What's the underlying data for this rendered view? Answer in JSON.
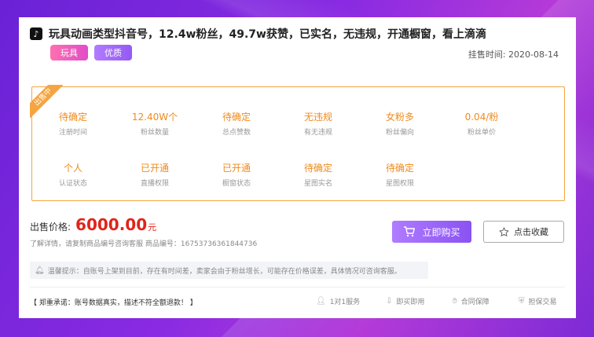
{
  "listing": {
    "title": "玩具动画类型抖音号，12.4w粉丝，49.7w获赞，已实名，无违规，开通橱窗，看上滴滴",
    "tags": [
      "玩具",
      "优质"
    ],
    "listed_date": "挂售时间: 2020-08-14",
    "status_ribbon": "出售中"
  },
  "stats": [
    {
      "value": "待确定",
      "label": "注册时间"
    },
    {
      "value": "12.40W个",
      "label": "粉丝数量"
    },
    {
      "value": "待确定",
      "label": "总点赞数"
    },
    {
      "value": "无违规",
      "label": "有无违规"
    },
    {
      "value": "女粉多",
      "label": "粉丝偏向"
    },
    {
      "value": "0.04/粉",
      "label": "粉丝单价"
    },
    {
      "value": "个人",
      "label": "认证状态"
    },
    {
      "value": "已开通",
      "label": "直播权限"
    },
    {
      "value": "已开通",
      "label": "橱窗状态"
    },
    {
      "value": "待确定",
      "label": "星图实名"
    },
    {
      "value": "待确定",
      "label": "星图权限"
    }
  ],
  "price": {
    "label": "出售价格:",
    "value": "6000.00",
    "unit": "元",
    "note": "了解详情，请复制商品编号咨询客服   商品编号：16753736361844736"
  },
  "actions": {
    "buy_label": "立即购买",
    "fav_label": "点击收藏"
  },
  "tips": "温馨提示：自账号上架到目前，存在有时间差，卖家会由于粉丝增长，可能存在价格误差，具体情况可咨询客服。",
  "footer": {
    "promise": "【 郑重承诺：账号数据真实，描述不符全额退款！ 】",
    "features": [
      "1对1服务",
      "即买即用",
      "合同保障",
      "担保交易"
    ]
  },
  "colors": {
    "accent_orange": "#f08a1c",
    "price_red": "#e0241b",
    "buy_purple": "#8a52f2"
  }
}
